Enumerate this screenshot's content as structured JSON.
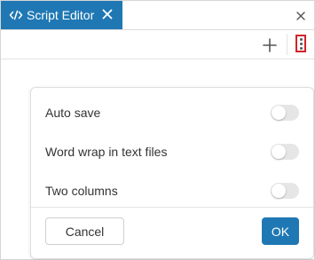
{
  "tab": {
    "title": "Script Editor",
    "icon": "code-icon",
    "close_icon": "close-icon",
    "color": "#1f78b4"
  },
  "window": {
    "close_icon": "close-icon"
  },
  "toolbar": {
    "add_icon": "plus-icon",
    "more_icon": "more-vertical-icon"
  },
  "settings": {
    "options": [
      {
        "label": "Auto save",
        "enabled": false
      },
      {
        "label": "Word wrap in text files",
        "enabled": false
      },
      {
        "label": "Two columns",
        "enabled": false
      }
    ],
    "cancel_label": "Cancel",
    "ok_label": "OK",
    "accent_color": "#1f78b4"
  }
}
